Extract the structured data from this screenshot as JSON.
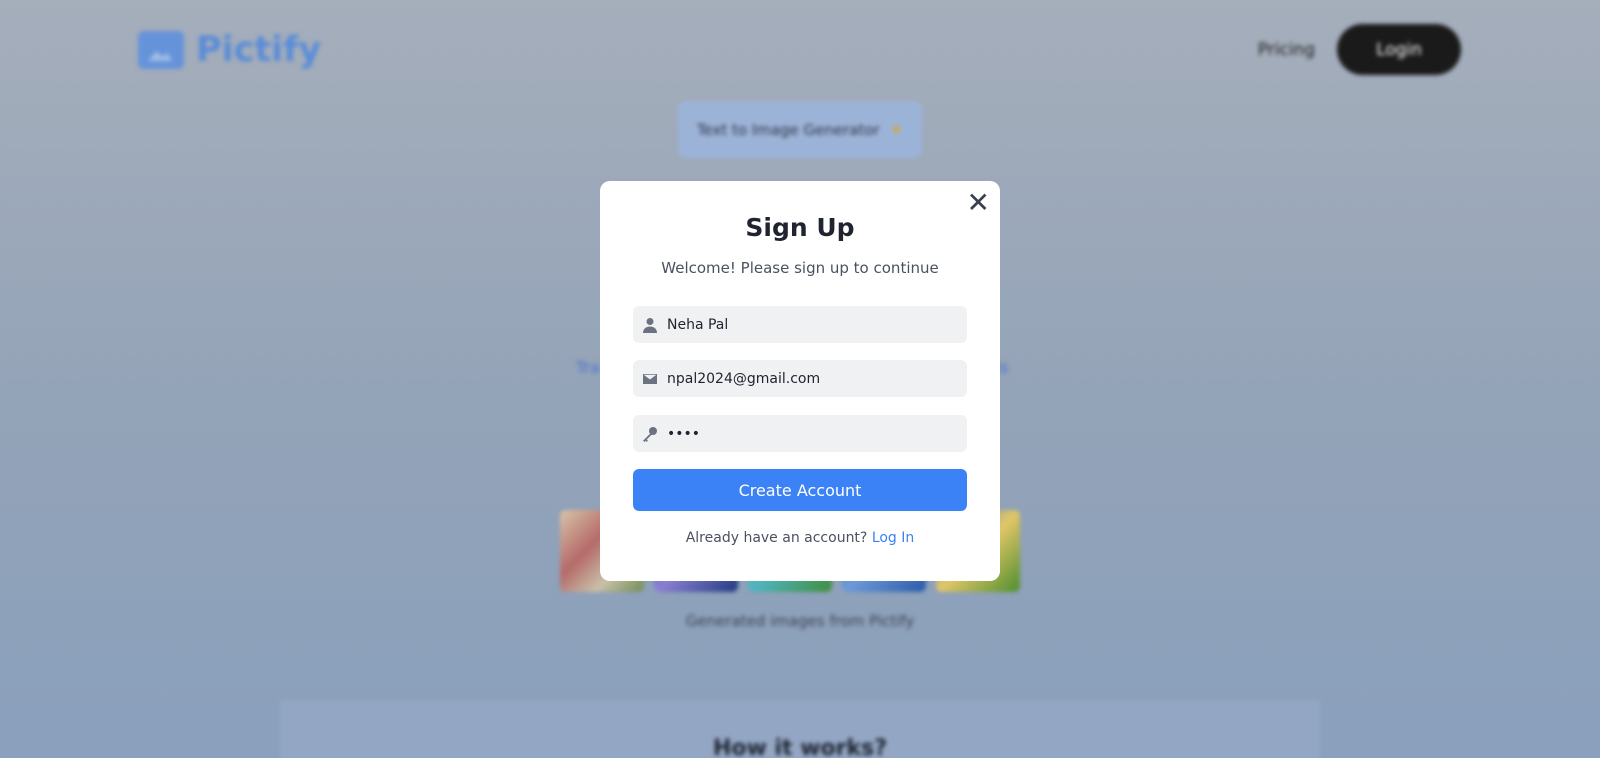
{
  "app": {
    "name": "Pictify"
  },
  "nav": {
    "pricing": "Pricing",
    "login": "Login"
  },
  "hero": {
    "badge": "Text to Image Generator",
    "left_fragment": "Tra",
    "right_fragment": "ds"
  },
  "gallery": {
    "caption": "Generated images from Pictify"
  },
  "how_it_works": {
    "title": "How it works?"
  },
  "modal": {
    "title": "Sign Up",
    "subtitle": "Welcome! Please sign up to continue",
    "name_value": "Neha Pal",
    "email_value": "npal2024@gmail.com",
    "password_value": "••••",
    "submit": "Create Account",
    "footer_text": "Already have an account?",
    "footer_link": "Log In"
  },
  "colors": {
    "primary": "#3b82f6",
    "overlay": "#9eacbd"
  }
}
